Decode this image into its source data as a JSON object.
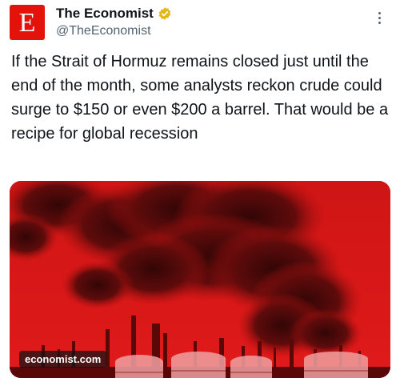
{
  "tweet": {
    "author": {
      "display_name": "The Economist",
      "handle": "@TheEconomist",
      "avatar_letter": "E",
      "verified_badge": "gold-check-badge"
    },
    "text": "If the Strait of Hormuz remains closed just until the end of the month, some analysts reckon crude could surge to $150 or even $200 a barrel. That would be a recipe for global recession",
    "media": {
      "link_domain": "economist.com",
      "description": "black smoke plume over refinery, red tinted"
    }
  },
  "colors": {
    "brand_red": "#e3120b",
    "badge_gold": "#e2b719",
    "image_red": "#d81212"
  }
}
